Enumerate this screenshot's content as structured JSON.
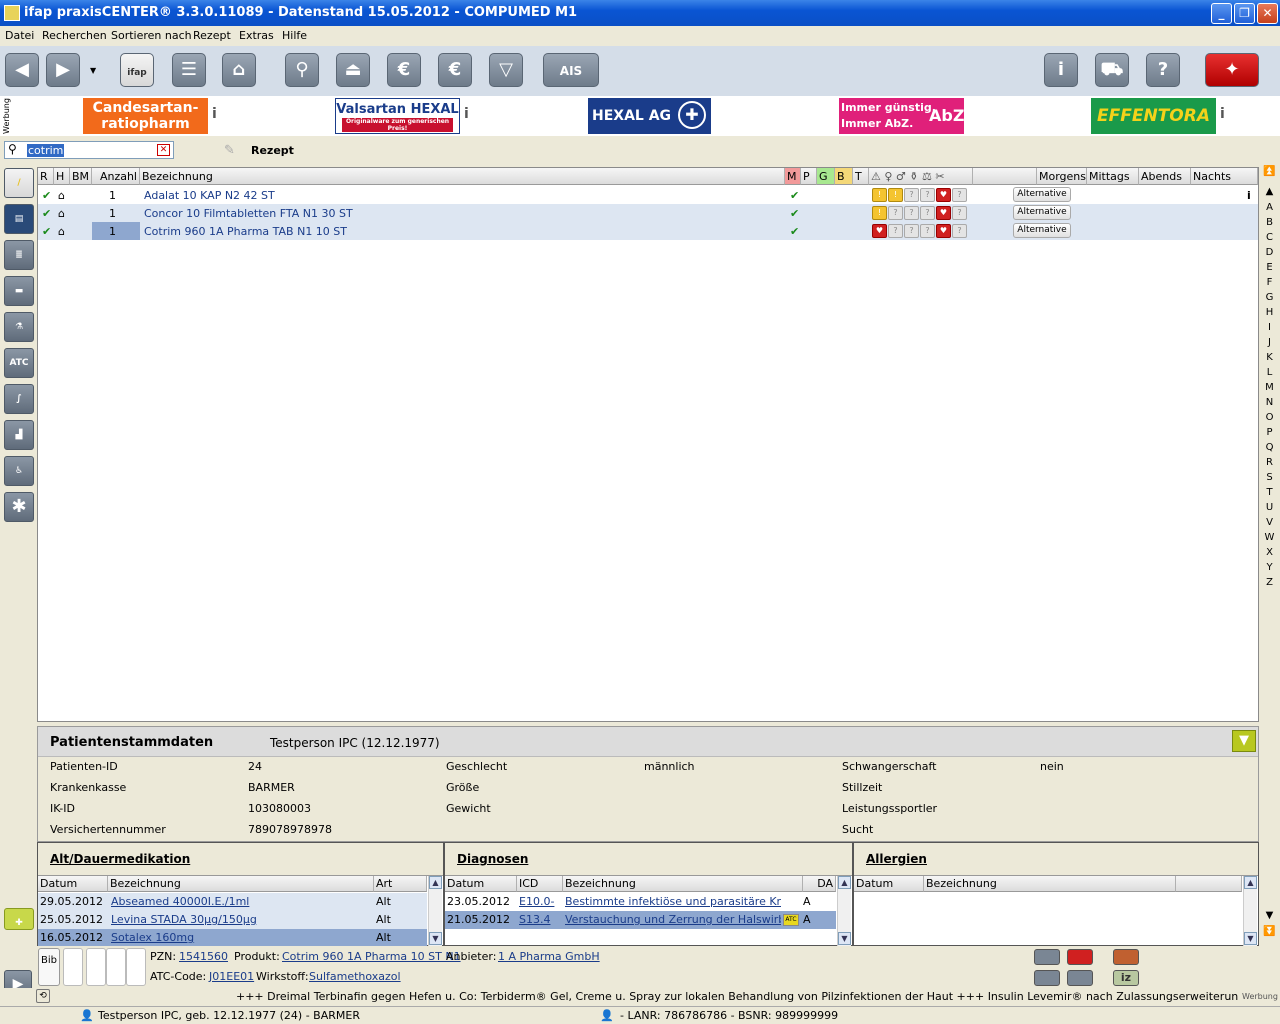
{
  "window": {
    "title": "ifap praxisCENTER® 3.3.0.11089 - Datenstand 15.05.2012 - COMPUMED M1"
  },
  "menu": [
    "Datei",
    "Recherchen",
    "Sortieren nach",
    "Rezept",
    "Extras",
    "Hilfe"
  ],
  "toolbar": {
    "ais_label": "AIS",
    "ifap_label": "ifap"
  },
  "ads": {
    "side_label": "Werbung",
    "candesartan": "Candesartan-ratiopharm",
    "valsartan_title": "Valsartan HEXAL",
    "valsartan_sub": "Originalware zum generischen Preis!",
    "hexal": "HEXAL AG",
    "abz_line1": "Immer günstig.",
    "abz_line2": "Immer AbZ.",
    "abz_logo": "AbZ",
    "effentora": "EFFENTORA",
    "info": "i"
  },
  "search": {
    "value": "cotrim",
    "rezept_label": "Rezept"
  },
  "grid": {
    "headers": {
      "r": "R",
      "h": "H",
      "bm": "BM",
      "anzahl": "Anzahl",
      "bezeichnung": "Bezeichnung",
      "m": "M",
      "p": "P",
      "g": "G",
      "b": "B",
      "t": "T",
      "morgens": "Morgens",
      "mittags": "Mittags",
      "abends": "Abends",
      "nachts": "Nachts"
    },
    "rows": [
      {
        "anzahl": "1",
        "bezeichnung": "Adalat 10 KAP N2 42 ST",
        "alt": "Alternative"
      },
      {
        "anzahl": "1",
        "bezeichnung": "Concor 10 Filmtabletten FTA N1 30 ST",
        "alt": "Alternative"
      },
      {
        "anzahl": "1",
        "bezeichnung": "Cotrim 960 1A Pharma TAB N1 10 ST",
        "alt": "Alternative"
      }
    ]
  },
  "alphabet": [
    "A",
    "B",
    "C",
    "D",
    "E",
    "F",
    "G",
    "H",
    "I",
    "J",
    "K",
    "L",
    "M",
    "N",
    "O",
    "P",
    "Q",
    "R",
    "S",
    "T",
    "U",
    "V",
    "W",
    "X",
    "Y",
    "Z"
  ],
  "patient": {
    "title": "Patientenstammdaten",
    "name": "Testperson IPC (12.12.1977)",
    "col1": [
      [
        "Patienten-ID",
        "24"
      ],
      [
        "Krankenkasse",
        "BARMER"
      ],
      [
        "IK-ID",
        "103080003"
      ],
      [
        "Versichertennummer",
        "789078978978"
      ]
    ],
    "col2": [
      [
        "Geschlecht",
        "männlich"
      ],
      [
        "Größe",
        ""
      ],
      [
        "Gewicht",
        ""
      ]
    ],
    "col3": [
      [
        "Schwangerschaft",
        "nein"
      ],
      [
        "Stillzeit",
        ""
      ],
      [
        "Leistungssportler",
        ""
      ],
      [
        "Sucht",
        ""
      ]
    ]
  },
  "medikation": {
    "title": "Alt/Dauermedikation",
    "headers": [
      "Datum",
      "Bezeichnung",
      "Art"
    ],
    "rows": [
      [
        "29.05.2012",
        "Abseamed 40000I.E./1ml",
        "Alt"
      ],
      [
        "25.05.2012",
        "Levina STADA 30µg/150µg",
        "Alt"
      ],
      [
        "16.05.2012",
        "Sotalex 160mg",
        "Alt"
      ]
    ]
  },
  "diagnosen": {
    "title": "Diagnosen",
    "headers": [
      "Datum",
      "ICD",
      "Bezeichnung",
      "DA"
    ],
    "rows": [
      [
        "23.05.2012",
        "E10.0-",
        "Bestimmte infektiöse und parasitäre Krankhei",
        "A"
      ],
      [
        "21.05.2012",
        "S13.4",
        "Verstauchung und Zerrung der Halswirbelsäu",
        "A"
      ]
    ],
    "atc_badge": "ATC"
  },
  "allergien": {
    "title": "Allergien",
    "headers": [
      "Datum",
      "Bezeichnung"
    ]
  },
  "info": {
    "bib": "Bib",
    "pzn_label": "PZN:",
    "pzn": "1541560",
    "produkt_label": "Produkt:",
    "produkt": "Cotrim 960 1A Pharma 10 ST N1",
    "anbieter_label": "Anbieter:",
    "anbieter": "1 A Pharma GmbH",
    "atc_label": "ATC-Code:",
    "atc": "J01EE01",
    "wirkstoff_label": "Wirkstoff:",
    "wirkstoff": "Sulfamethoxazol",
    "iz": "iz"
  },
  "ticker": {
    "text": "+++ Dreimal Terbinafin gegen Hefen u. Co: Terbiderm® Gel, Creme u. Spray zur lokalen Behandlung von Pilzinfektionen der Haut +++ Insulin Levemir® nach Zulassungserweiterung für Kinder im Alter von zwe",
    "label": "Werbung"
  },
  "status": {
    "patient": "Testperson IPC, geb. 12.12.1977 (24) - BARMER",
    "lanr": "- LANR: 786786786 - BSNR: 989999999"
  },
  "colors": {
    "title_blue": "#0a55d3",
    "link": "#1a3c8a",
    "check": "#1a8a1a",
    "selected": "#8ea7cf",
    "abz_pink": "#e0207a",
    "effentora_green": "#1a9a4a",
    "hexal_blue": "#1a3c8a"
  }
}
